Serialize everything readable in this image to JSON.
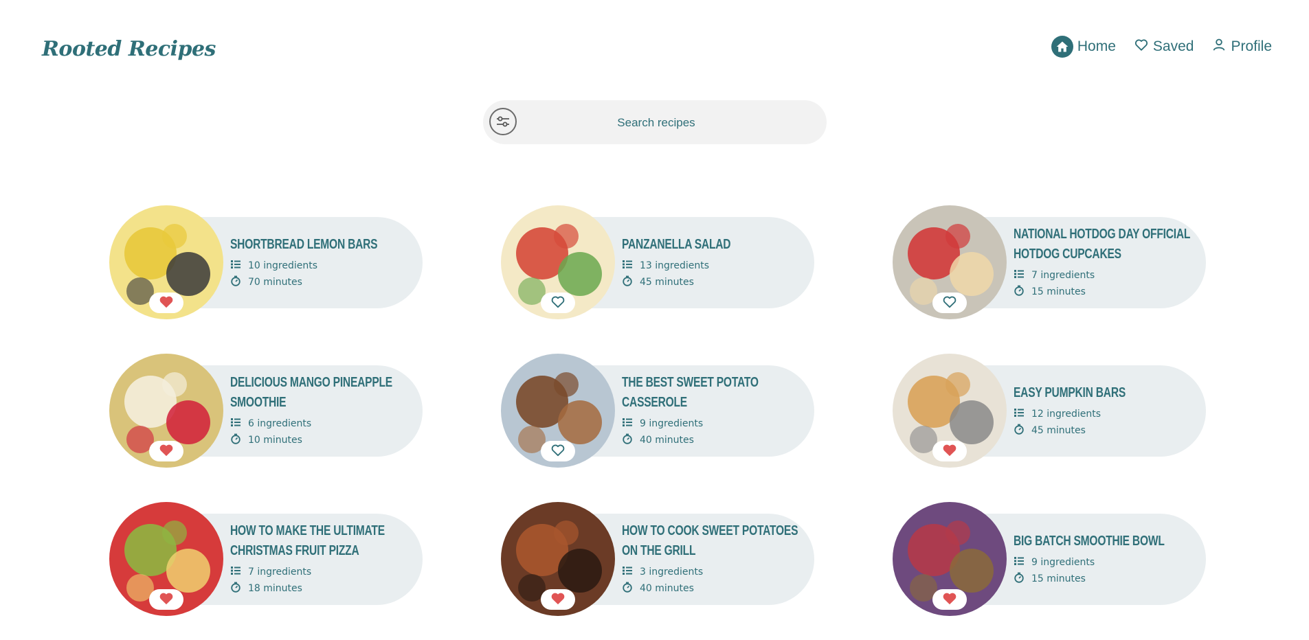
{
  "brand": {
    "name": "Rooted Recipes"
  },
  "nav": {
    "home": "Home",
    "saved": "Saved",
    "profile": "Profile"
  },
  "search": {
    "placeholder": "Search recipes"
  },
  "colors": {
    "primary": "#2f6f78",
    "heart": "#e05454",
    "card_bg": "#e9eef0"
  },
  "recipes": [
    {
      "title": "Shortbread Lemon Bars",
      "ingredients": "10 ingredients",
      "time": "70 minutes",
      "saved": true,
      "image": "lemon-bars"
    },
    {
      "title": "Panzanella Salad",
      "ingredients": "13 ingredients",
      "time": "45 minutes",
      "saved": false,
      "image": "panzanella-salad"
    },
    {
      "title": "National Hotdog Day Official Hotdog Cupcakes",
      "ingredients": "7 ingredients",
      "time": "15 minutes",
      "saved": false,
      "image": "hotdog-cupcakes"
    },
    {
      "title": "Delicious Mango Pineapple Smoothie",
      "ingredients": "6 ingredients",
      "time": "10 minutes",
      "saved": true,
      "image": "mango-smoothie"
    },
    {
      "title": "The Best Sweet Potato Casserole",
      "ingredients": "9 ingredients",
      "time": "40 minutes",
      "saved": false,
      "image": "sweet-potato-casserole"
    },
    {
      "title": "Easy Pumpkin Bars",
      "ingredients": "12 ingredients",
      "time": "45 minutes",
      "saved": true,
      "image": "pumpkin-bars"
    },
    {
      "title": "How to Make the Ultimate Christmas Fruit Pizza",
      "ingredients": "7 ingredients",
      "time": "18 minutes",
      "saved": true,
      "image": "fruit-pizza"
    },
    {
      "title": "How to Cook Sweet Potatoes on the Grill",
      "ingredients": "3 ingredients",
      "time": "40 minutes",
      "saved": true,
      "image": "grilled-sweet-potatoes"
    },
    {
      "title": "Big Batch Smoothie Bowl",
      "ingredients": "9 ingredients",
      "time": "15 minutes",
      "saved": true,
      "image": "smoothie-bowl"
    }
  ]
}
